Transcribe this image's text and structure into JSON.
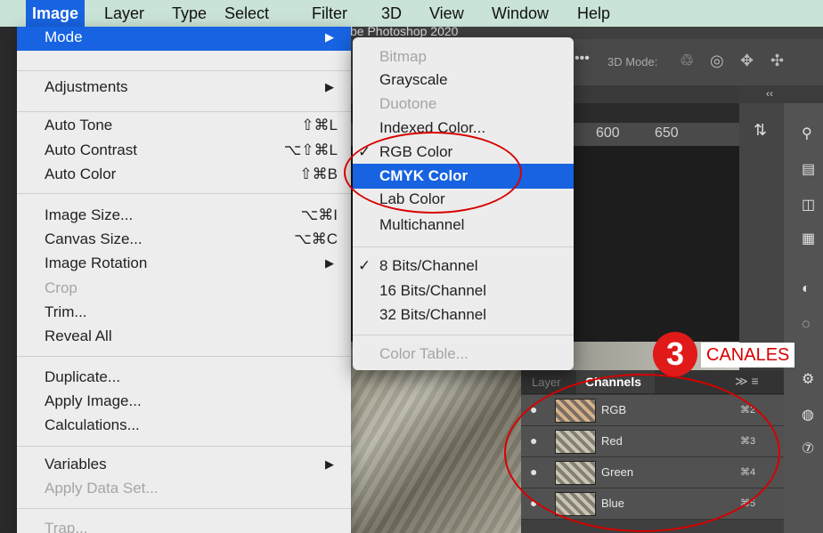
{
  "menubar": {
    "items": [
      "Image",
      "Layer",
      "Type",
      "Select",
      "Filter",
      "3D",
      "View",
      "Window",
      "Help"
    ],
    "active_index": 0
  },
  "photoshop": {
    "window_title": "be Photoshop 2020",
    "options_bar": {
      "mode_label": "3D Mode:"
    },
    "ruler": {
      "marks": [
        "600",
        "650"
      ]
    },
    "dock_chevron": "‹‹"
  },
  "image_menu": {
    "items": [
      {
        "label": "Mode",
        "shortcut": "",
        "submenu": true,
        "highlighted": true,
        "disabled": false
      },
      {
        "label": "Adjustments",
        "shortcut": "",
        "submenu": true,
        "highlighted": false,
        "disabled": false
      },
      {
        "label": "Auto Tone",
        "shortcut": "⇧⌘L",
        "submenu": false,
        "highlighted": false,
        "disabled": false
      },
      {
        "label": "Auto Contrast",
        "shortcut": "⌥⇧⌘L",
        "submenu": false,
        "highlighted": false,
        "disabled": false
      },
      {
        "label": "Auto Color",
        "shortcut": "⇧⌘B",
        "submenu": false,
        "highlighted": false,
        "disabled": false
      },
      {
        "label": "Image Size...",
        "shortcut": "⌥⌘I",
        "submenu": false,
        "highlighted": false,
        "disabled": false
      },
      {
        "label": "Canvas Size...",
        "shortcut": "⌥⌘C",
        "submenu": false,
        "highlighted": false,
        "disabled": false
      },
      {
        "label": "Image Rotation",
        "shortcut": "",
        "submenu": true,
        "highlighted": false,
        "disabled": false
      },
      {
        "label": "Crop",
        "shortcut": "",
        "submenu": false,
        "highlighted": false,
        "disabled": true
      },
      {
        "label": "Trim...",
        "shortcut": "",
        "submenu": false,
        "highlighted": false,
        "disabled": false
      },
      {
        "label": "Reveal All",
        "shortcut": "",
        "submenu": false,
        "highlighted": false,
        "disabled": false
      },
      {
        "label": "Duplicate...",
        "shortcut": "",
        "submenu": false,
        "highlighted": false,
        "disabled": false
      },
      {
        "label": "Apply Image...",
        "shortcut": "",
        "submenu": false,
        "highlighted": false,
        "disabled": false
      },
      {
        "label": "Calculations...",
        "shortcut": "",
        "submenu": false,
        "highlighted": false,
        "disabled": false
      },
      {
        "label": "Variables",
        "shortcut": "",
        "submenu": true,
        "highlighted": false,
        "disabled": false
      },
      {
        "label": "Apply Data Set...",
        "shortcut": "",
        "submenu": false,
        "highlighted": false,
        "disabled": true
      },
      {
        "label": "Trap...",
        "shortcut": "",
        "submenu": false,
        "highlighted": false,
        "disabled": true
      }
    ]
  },
  "mode_menu": {
    "items": [
      {
        "label": "Bitmap",
        "checked": false,
        "highlighted": false,
        "disabled": true
      },
      {
        "label": "Grayscale",
        "checked": false,
        "highlighted": false,
        "disabled": false
      },
      {
        "label": "Duotone",
        "checked": false,
        "highlighted": false,
        "disabled": true
      },
      {
        "label": "Indexed Color...",
        "checked": false,
        "highlighted": false,
        "disabled": false
      },
      {
        "label": "RGB Color",
        "checked": true,
        "highlighted": false,
        "disabled": false
      },
      {
        "label": "CMYK Color",
        "checked": false,
        "highlighted": true,
        "disabled": false
      },
      {
        "label": "Lab Color",
        "checked": false,
        "highlighted": false,
        "disabled": false
      },
      {
        "label": "Multichannel",
        "checked": false,
        "highlighted": false,
        "disabled": false
      },
      {
        "label": "8 Bits/Channel",
        "checked": true,
        "highlighted": false,
        "disabled": false
      },
      {
        "label": "16 Bits/Channel",
        "checked": false,
        "highlighted": false,
        "disabled": false
      },
      {
        "label": "32 Bits/Channel",
        "checked": false,
        "highlighted": false,
        "disabled": false
      },
      {
        "label": "Color Table...",
        "checked": false,
        "highlighted": false,
        "disabled": true
      }
    ],
    "check_glyph": "✓"
  },
  "channels_panel": {
    "layers_tab": "Layer",
    "tab": "Channels",
    "menu_icon": "≫ ≡",
    "rows": [
      {
        "name": "RGB",
        "shortcut": "⌘2"
      },
      {
        "name": "Red",
        "shortcut": "⌘3"
      },
      {
        "name": "Green",
        "shortcut": "⌘4"
      },
      {
        "name": "Blue",
        "shortcut": "⌘5"
      }
    ]
  },
  "annotation": {
    "step_number": "3",
    "label": "CANALES",
    "highlight_color": "#d80000"
  },
  "colors": {
    "menu_highlight": "#1763e1",
    "menu_bg": "#ededed",
    "menubar_bg": "#c9e3d6"
  },
  "icons": {
    "submenu_arrow": "submenu-arrow-icon",
    "eye": "eye-icon",
    "channel_thumbnail": "channel-thumbnail-icon"
  }
}
